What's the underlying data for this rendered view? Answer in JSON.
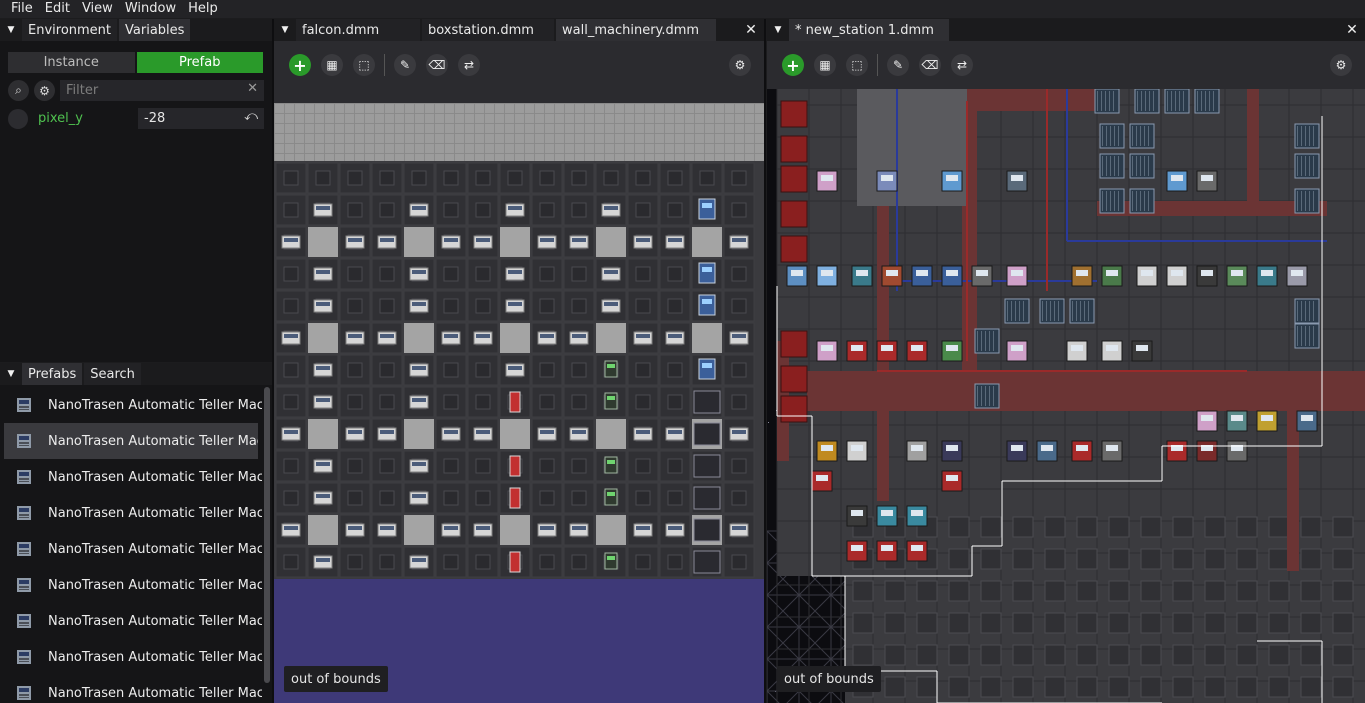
{
  "menu": [
    "File",
    "Edit",
    "View",
    "Window",
    "Help"
  ],
  "left_top": {
    "tabs": [
      "Environment",
      "Variables"
    ],
    "mode_tabs": [
      "Instance",
      "Prefab"
    ],
    "filter_placeholder": "Filter",
    "property": {
      "name": "pixel_y",
      "value": "-28"
    }
  },
  "left_bottom": {
    "tabs": [
      "Prefabs",
      "Search"
    ],
    "items": [
      "NanoTrasen Automatic Teller Mac",
      "NanoTrasen Automatic Teller Mac",
      "NanoTrasen Automatic Teller Mac",
      "NanoTrasen Automatic Teller Mac",
      "NanoTrasen Automatic Teller Mac",
      "NanoTrasen Automatic Teller Mac",
      "NanoTrasen Automatic Teller Mac",
      "NanoTrasen Automatic Teller Mac",
      "NanoTrasen Automatic Teller Mac"
    ],
    "selected_index": 1
  },
  "editor_a": {
    "tabs": [
      "falcon.dmm",
      "boxstation.dmm",
      "wall_machinery.dmm"
    ],
    "status": "out of bounds"
  },
  "editor_b": {
    "tabs": [
      "* new_station 1.dmm"
    ],
    "status": "out of bounds"
  },
  "icons": {
    "add": "plus-icon",
    "grid": "grid-icon",
    "select": "select-icon",
    "pick": "eyedropper-icon",
    "erase": "eraser-icon",
    "replace": "replace-icon",
    "settings": "gear-icon"
  },
  "colors": {
    "accent_green": "#2a9a2a",
    "property_green": "#4fc14f",
    "void_purple": "#3e3978"
  }
}
